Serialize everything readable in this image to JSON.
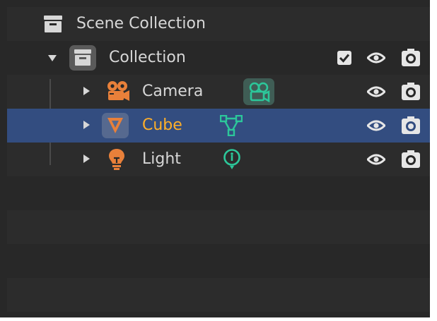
{
  "outliner": {
    "scene_collection": {
      "label": "Scene Collection",
      "icon": "scene-collection-icon"
    },
    "collection": {
      "label": "Collection",
      "expanded": true,
      "icon": "collection-box-icon",
      "exclude_checked": true
    },
    "objects": [
      {
        "label": "Camera",
        "object_icon": "camera-object-icon",
        "data_icon": "camera-data-icon",
        "selected": false,
        "active": false
      },
      {
        "label": "Cube",
        "object_icon": "mesh-object-icon",
        "data_icon": "mesh-data-icon",
        "selected": true,
        "active": true
      },
      {
        "label": "Light",
        "object_icon": "light-object-icon",
        "data_icon": "light-data-icon",
        "selected": false,
        "active": false
      }
    ]
  },
  "colors": {
    "background": "#282828",
    "row_stripe": "#2c2c2c",
    "selection": "#334d80",
    "text": "#d7d7d7",
    "active_text": "#ffaf29",
    "object_icon": "#e8803a",
    "data_icon": "#2cc79a"
  }
}
